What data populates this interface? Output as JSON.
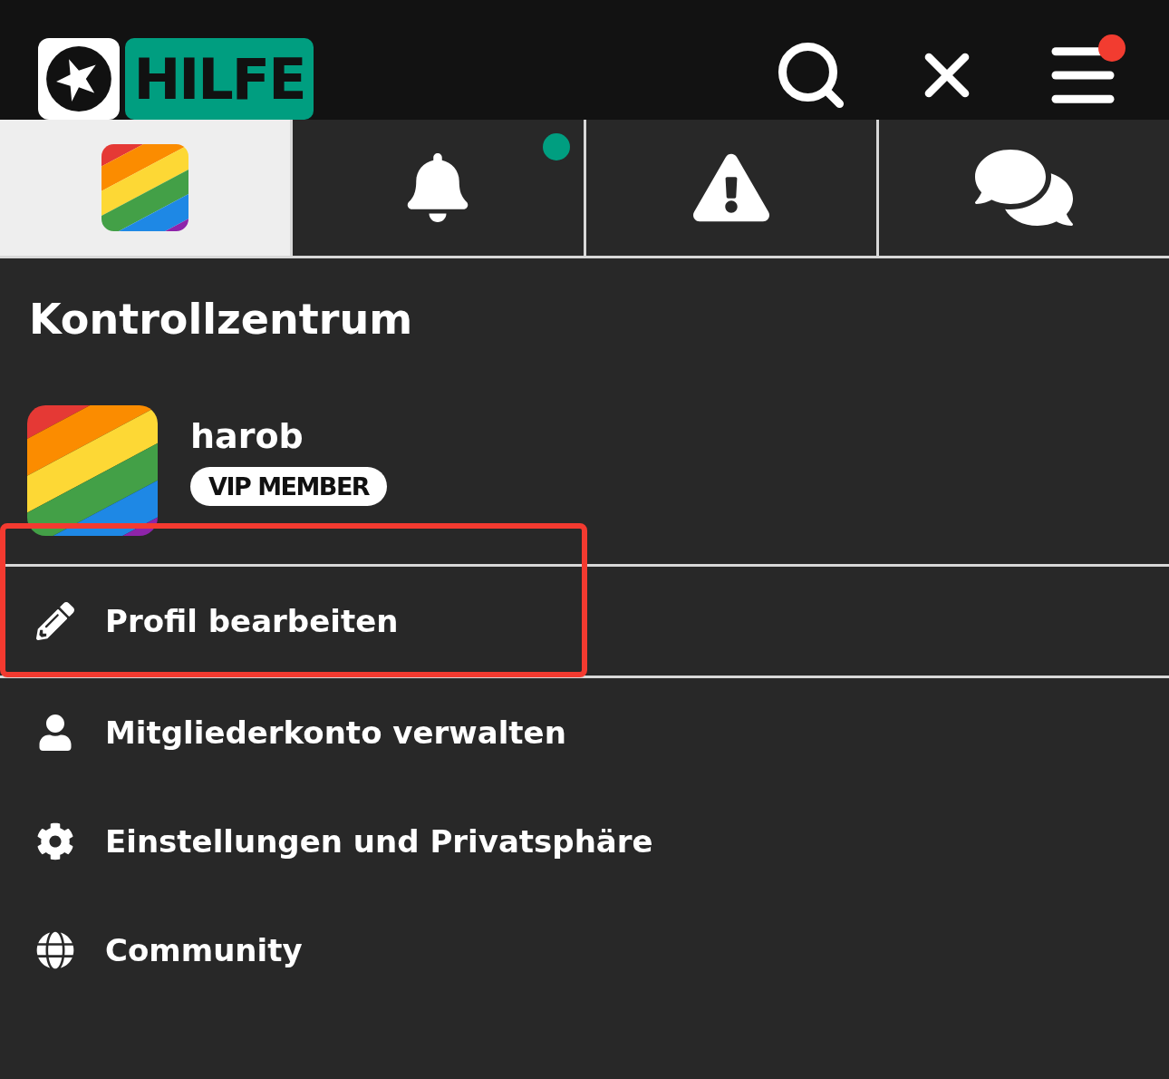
{
  "header": {
    "logo": {
      "text": "HILFE"
    },
    "menu_badge": true
  },
  "tabs": [
    {
      "kind": "avatar",
      "selected": true,
      "dot": false
    },
    {
      "kind": "bell",
      "selected": false,
      "dot": true
    },
    {
      "kind": "warning",
      "selected": false,
      "dot": false
    },
    {
      "kind": "chat",
      "selected": false,
      "dot": false
    }
  ],
  "title": "Kontrollzentrum",
  "profile": {
    "name": "harob",
    "badge": "VIP MEMBER"
  },
  "menu": [
    {
      "kind": "edit",
      "label": "Profil bearbeiten",
      "highlighted": true
    },
    {
      "kind": "account",
      "label": "Mitgliederkonto verwalten",
      "highlighted": false
    },
    {
      "kind": "settings",
      "label": "Einstellungen und Privatsphäre",
      "highlighted": false
    },
    {
      "kind": "community",
      "label": "Community",
      "highlighted": false
    }
  ]
}
